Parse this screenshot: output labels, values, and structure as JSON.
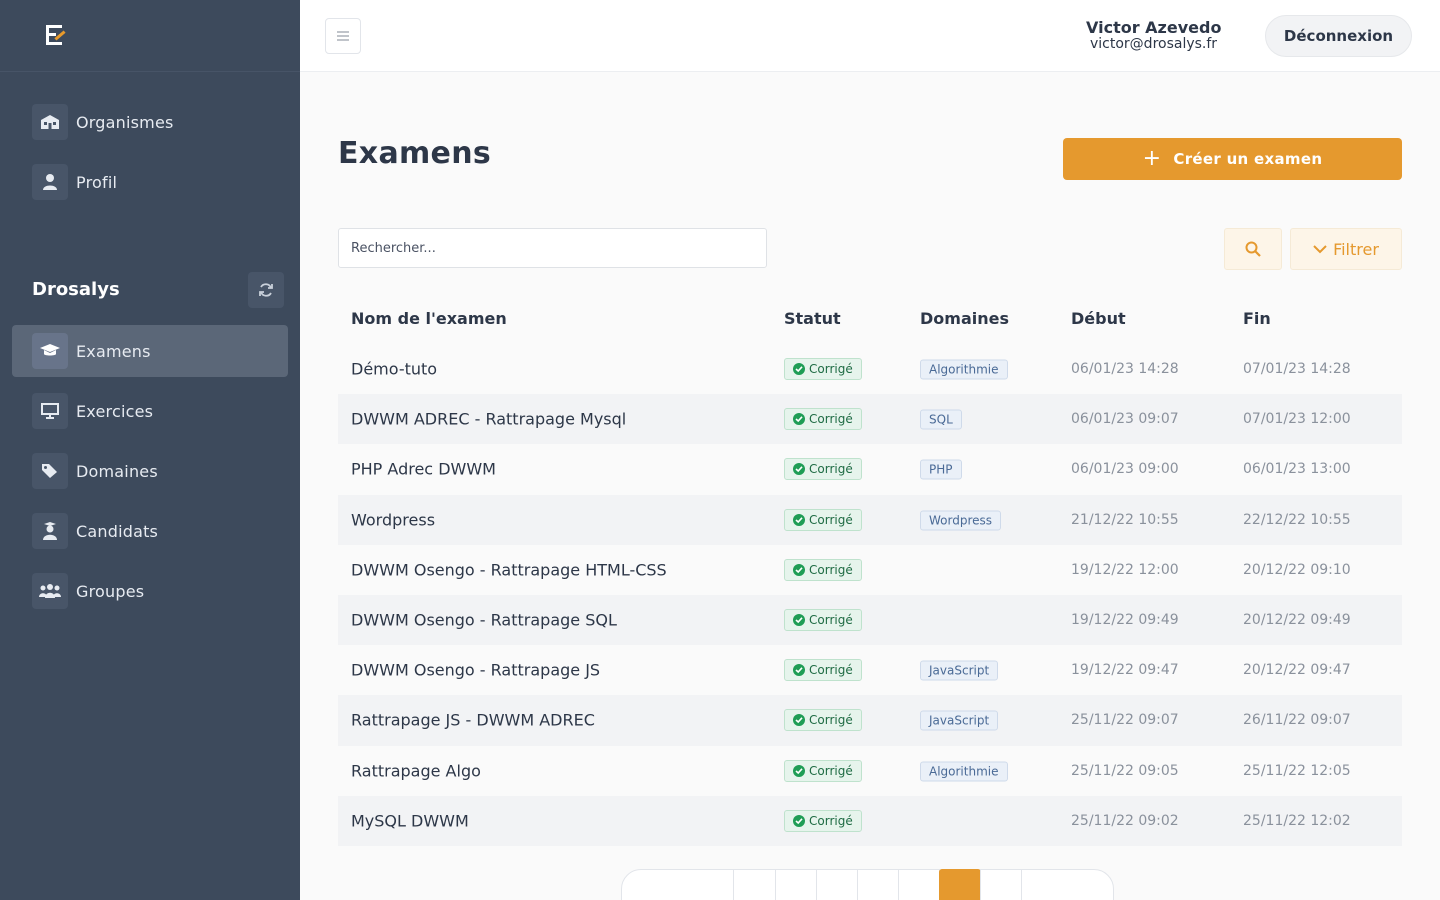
{
  "app": {
    "org_name": "Drosalys"
  },
  "sidebar": {
    "top_items": [
      {
        "label": "Organismes",
        "icon": "building-icon"
      },
      {
        "label": "Profil",
        "icon": "user-icon"
      }
    ],
    "org_items": [
      {
        "label": "Examens",
        "icon": "graduation-cap-icon",
        "active": true
      },
      {
        "label": "Exercices",
        "icon": "presentation-icon",
        "active": false
      },
      {
        "label": "Domaines",
        "icon": "tags-icon",
        "active": false
      },
      {
        "label": "Candidats",
        "icon": "student-icon",
        "active": false
      },
      {
        "label": "Groupes",
        "icon": "users-icon",
        "active": false
      }
    ]
  },
  "header": {
    "user_name": "Victor Azevedo",
    "user_email": "victor@drosalys.fr",
    "logout_label": "Déconnexion"
  },
  "main": {
    "title": "Examens",
    "create_label": "Créer un examen",
    "search_placeholder": "Rechercher...",
    "filter_label": "Filtrer",
    "accent_color": "#e5992e"
  },
  "table": {
    "headers": {
      "name": "Nom de l'examen",
      "status": "Statut",
      "domains": "Domaines",
      "start": "Début",
      "end": "Fin"
    },
    "rows": [
      {
        "name": "Démo-tuto",
        "status": "Corrigé",
        "domain": "Algorithmie",
        "start": "06/01/23 14:28",
        "end": "07/01/23 14:28"
      },
      {
        "name": "DWWM ADREC - Rattrapage Mysql",
        "status": "Corrigé",
        "domain": "SQL",
        "start": "06/01/23 09:07",
        "end": "07/01/23 12:00"
      },
      {
        "name": "PHP Adrec DWWM",
        "status": "Corrigé",
        "domain": "PHP",
        "start": "06/01/23 09:00",
        "end": "06/01/23 13:00"
      },
      {
        "name": "Wordpress",
        "status": "Corrigé",
        "domain": "Wordpress",
        "start": "21/12/22 10:55",
        "end": "22/12/22 10:55"
      },
      {
        "name": "DWWM Osengo - Rattrapage HTML-CSS",
        "status": "Corrigé",
        "domain": "",
        "start": "19/12/22 12:00",
        "end": "20/12/22 09:10"
      },
      {
        "name": "DWWM Osengo - Rattrapage SQL",
        "status": "Corrigé",
        "domain": "",
        "start": "19/12/22 09:49",
        "end": "20/12/22 09:49"
      },
      {
        "name": "DWWM Osengo - Rattrapage JS",
        "status": "Corrigé",
        "domain": "JavaScript",
        "start": "19/12/22 09:47",
        "end": "20/12/22 09:47"
      },
      {
        "name": "Rattrapage JS - DWWM ADREC",
        "status": "Corrigé",
        "domain": "JavaScript",
        "start": "25/11/22 09:07",
        "end": "26/11/22 09:07"
      },
      {
        "name": "Rattrapage Algo",
        "status": "Corrigé",
        "domain": "Algorithmie",
        "start": "25/11/22 09:05",
        "end": "25/11/22 12:05"
      },
      {
        "name": "MySQL DWWM",
        "status": "Corrigé",
        "domain": "",
        "start": "25/11/22 09:02",
        "end": "25/11/22 12:02"
      }
    ]
  }
}
